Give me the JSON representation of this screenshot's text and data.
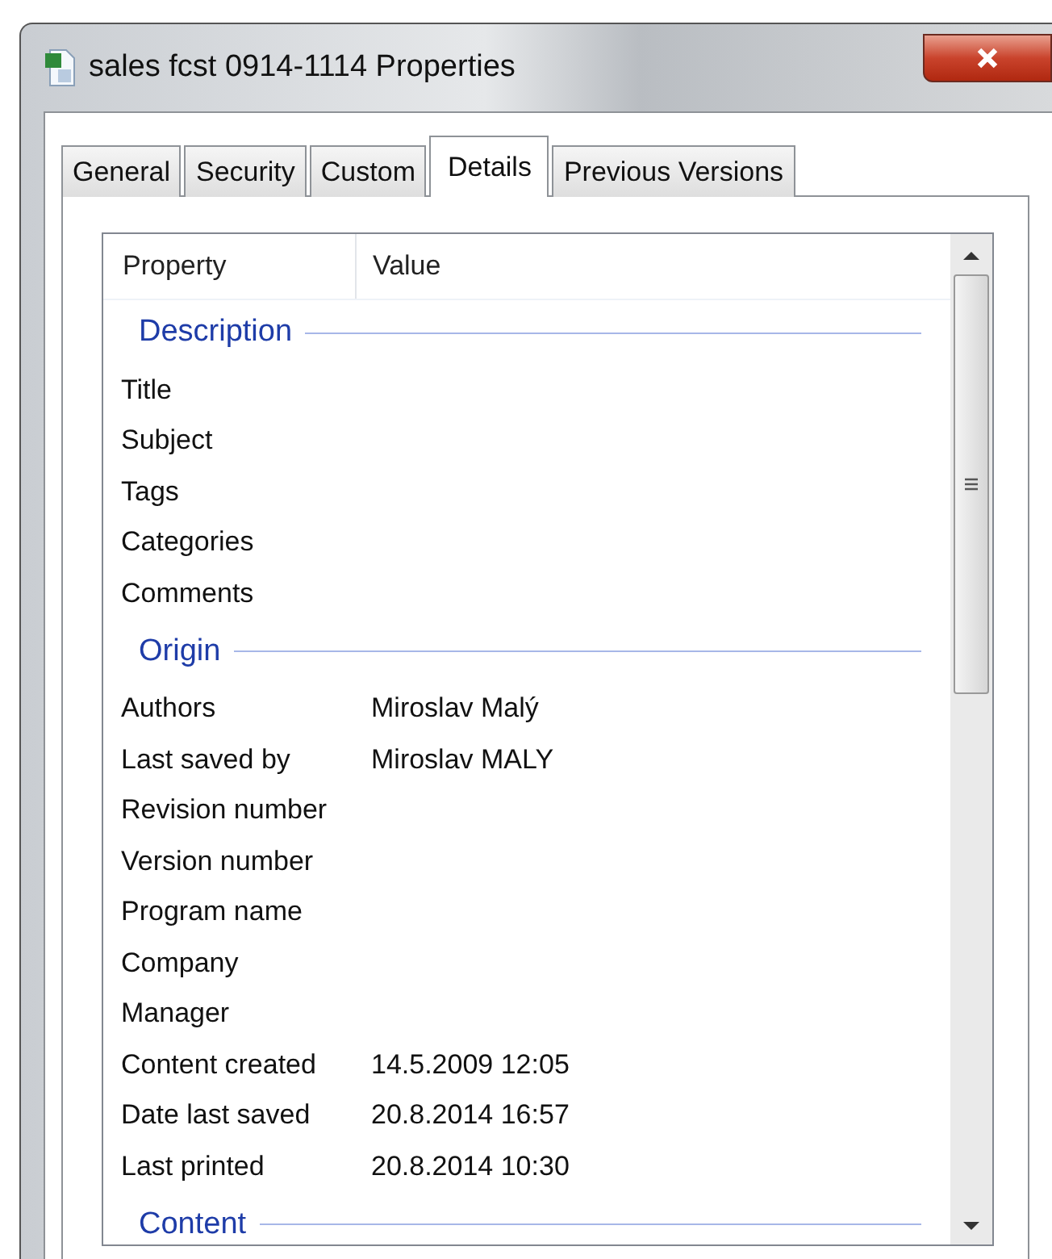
{
  "window": {
    "title": "sales fcst 0914-1114 Properties"
  },
  "tabs": [
    {
      "label": "General",
      "selected": false
    },
    {
      "label": "Security",
      "selected": false
    },
    {
      "label": "Custom",
      "selected": false
    },
    {
      "label": "Details",
      "selected": true
    },
    {
      "label": "Previous Versions",
      "selected": false
    }
  ],
  "table": {
    "columns": [
      "Property",
      "Value"
    ],
    "sections": [
      {
        "title": "Description",
        "rows": [
          {
            "property": "Title"
          },
          {
            "property": "Subject"
          },
          {
            "property": "Tags"
          },
          {
            "property": "Categories"
          },
          {
            "property": "Comments"
          }
        ]
      },
      {
        "title": "Origin",
        "rows": [
          {
            "property": "Authors",
            "value": "Miroslav Malý"
          },
          {
            "property": "Last saved by",
            "value": "Miroslav MALY"
          },
          {
            "property": "Revision number"
          },
          {
            "property": "Version number"
          },
          {
            "property": "Program name"
          },
          {
            "property": "Company"
          },
          {
            "property": "Manager"
          },
          {
            "property": "Content created",
            "value": "14.5.2009 12:05"
          },
          {
            "property": "Date last saved",
            "value": "20.8.2014 16:57"
          },
          {
            "property": "Last printed",
            "value": "20.8.2014 10:30"
          }
        ]
      },
      {
        "title": "Content"
      }
    ]
  }
}
